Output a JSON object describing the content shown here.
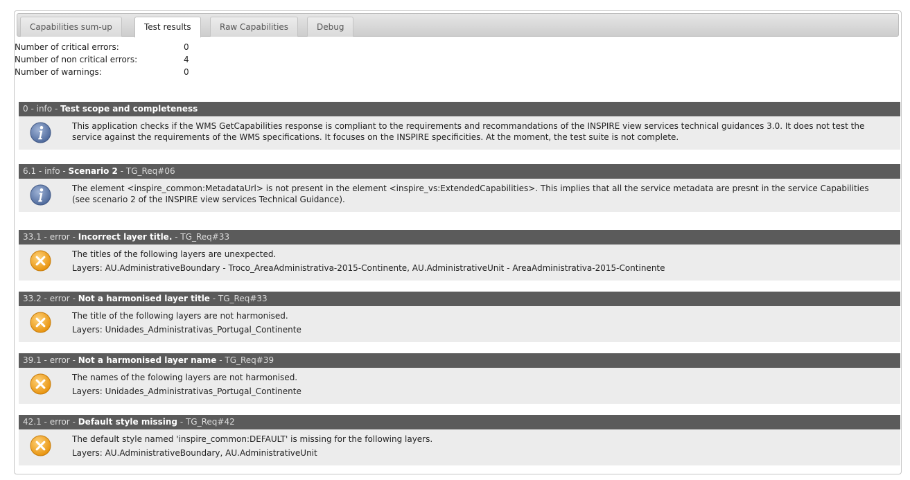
{
  "tabs": [
    {
      "label": "Capabilities sum-up",
      "active": false
    },
    {
      "label": "Test results",
      "active": true
    },
    {
      "label": "Raw Capabilities",
      "active": false
    },
    {
      "label": "Debug",
      "active": false
    }
  ],
  "summary": [
    {
      "label": "Number of critical errors:",
      "value": "0"
    },
    {
      "label": "Number of non critical errors:",
      "value": "4"
    },
    {
      "label": "Number of warnings:",
      "value": "0"
    }
  ],
  "messages": [
    {
      "id": "0",
      "severity": "info",
      "title": "Test scope and completeness",
      "req": "",
      "icon": "info-icon",
      "lines": [
        "This application checks if the WMS GetCapabilities response is compliant to the requirements and recommandations of the INSPIRE view services technical guidances 3.0. It does not test the service against the requirements of the WMS specifications. It focuses on the INSPIRE specificities. At the moment, the test suite is not complete."
      ]
    },
    {
      "id": "6.1",
      "severity": "info",
      "title": "Scenario 2",
      "req": "TG_Req#06",
      "icon": "info-icon",
      "lines": [
        "The element <inspire_common:MetadataUrl> is not present in the element <inspire_vs:ExtendedCapabilities>. This implies that all the service metadata are presnt in the service Capabilities (see scenario 2 of the INSPIRE view services Technical Guidance)."
      ]
    },
    {
      "id": "33.1",
      "severity": "error",
      "title": "Incorrect layer title.",
      "req": "TG_Req#33",
      "icon": "error-icon",
      "lines": [
        "The titles of the following layers are unexpected.",
        "Layers: AU.AdministrativeBoundary - Troco_AreaAdministrativa-2015-Continente, AU.AdministrativeUnit - AreaAdministrativa-2015-Continente"
      ]
    },
    {
      "id": "33.2",
      "severity": "error",
      "title": "Not a harmonised layer title",
      "req": "TG_Req#33",
      "icon": "error-icon",
      "lines": [
        "The title of the following layers are not harmonised.",
        "Layers: Unidades_Administrativas_Portugal_Continente"
      ]
    },
    {
      "id": "39.1",
      "severity": "error",
      "title": "Not a harmonised layer name",
      "req": "TG_Req#39",
      "icon": "error-icon",
      "lines": [
        "The names of the folowing layers are not harmonised.",
        "Layers: Unidades_Administrativas_Portugal_Continente"
      ]
    },
    {
      "id": "42.1",
      "severity": "error",
      "title": "Default style missing",
      "req": "TG_Req#42",
      "icon": "error-icon",
      "lines": [
        "The default style named 'inspire_common:DEFAULT' is missing for the following layers.",
        "Layers: AU.AdministrativeBoundary, AU.AdministrativeUnit"
      ]
    }
  ],
  "colors": {
    "header_bg": "#5b5b5b",
    "body_bg": "#ececec",
    "info_icon": "#5e78a8",
    "error_icon": "#f0a020"
  }
}
